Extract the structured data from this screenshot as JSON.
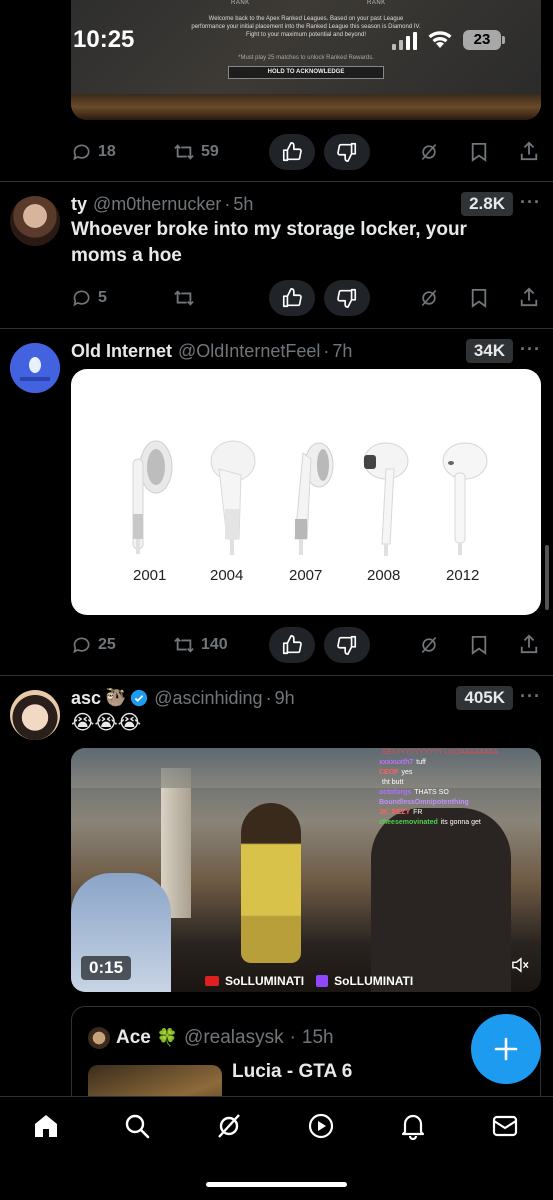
{
  "status_bar": {
    "time": "10:25",
    "battery": "23"
  },
  "top_post": {
    "media": {
      "rank_left": "RANK",
      "rank_right": "RANK",
      "message": "Welcome back to the Apex Ranked Leagues. Based on your past League performance your initial placement into the Ranked League this season is Diamond IV. Fight to your maximum potential and beyond!",
      "note": "*Must play 25 matches to unlock Ranked Rewards.",
      "ack": "HOLD TO ACKNOWLEDGE"
    },
    "replies": "18",
    "reposts": "59"
  },
  "posts": [
    {
      "name": "ty",
      "handle": "@m0thernucker",
      "time": "5h",
      "views": "2.8K",
      "text": "Whoever broke into my storage locker, your moms a hoe",
      "replies": "5",
      "reposts": ""
    },
    {
      "name": "Old Internet",
      "handle": "@OldInternetFeel",
      "time": "7h",
      "views": "34K",
      "years": [
        "2001",
        "2004",
        "2007",
        "2008",
        "2012"
      ],
      "replies": "25",
      "reposts": "140"
    },
    {
      "name": "asc",
      "name_emoji": "🦥",
      "handle": "@ascinhiding",
      "time": "9h",
      "views": "405K",
      "text": "😭😭😭",
      "video": {
        "duration": "0:15",
        "chat": [
          {
            "user": "",
            "msg": "SEXYYYYYYYYYY LUCIAAAAAAAA",
            "color": "#e05050"
          },
          {
            "user": "xxxxuxth7",
            "msg": "tuff",
            "color": "#c070ff"
          },
          {
            "user": "CEOF",
            "msg": "yes",
            "color": "#ff6060"
          },
          {
            "user": "",
            "msg": "tht butt",
            "color": "#ff6060"
          },
          {
            "user": "octoforgs",
            "msg": "THATS SO",
            "color": "#b070ff"
          },
          {
            "user": "BoundlessOmnipotenthing",
            "msg": "",
            "color": "#c090ff"
          },
          {
            "user": "JK_EEZY",
            "msg": "FR",
            "color": "#ff6060"
          },
          {
            "user": "cheesemovinated",
            "msg": "its gonna get",
            "color": "#50d050"
          }
        ],
        "banner_yt": "SoLLUMINATI",
        "banner_tw": "SoLLUMINATI"
      },
      "quote": {
        "name": "Ace",
        "name_emoji": "🍀",
        "handle": "@realasysk",
        "time": "15h",
        "text": "Lucia - GTA 6"
      }
    }
  ],
  "colors": {
    "accent": "#1d9bf0",
    "muted": "#71767b",
    "divider": "#2f3336",
    "verified": "#1d9bf0"
  },
  "nav": [
    "home-icon",
    "search-icon",
    "grok-icon",
    "video-icon",
    "notifications-icon",
    "messages-icon"
  ]
}
